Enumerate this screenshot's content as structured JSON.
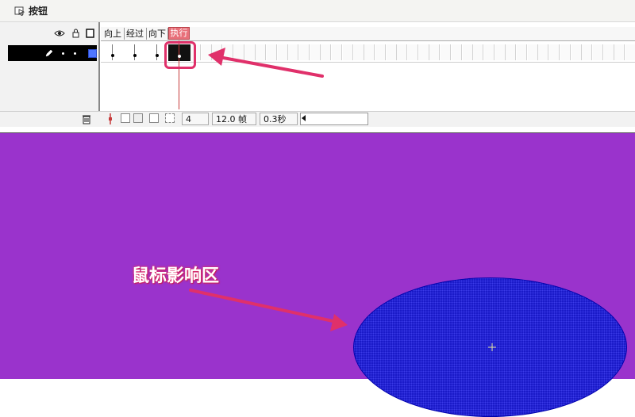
{
  "scene": {
    "label": "按钮",
    "icon": "button-symbol-icon"
  },
  "timeline": {
    "layer_header_icons": [
      "eye-icon",
      "lock-icon",
      "outline-icon"
    ],
    "layer": {
      "icons": [
        "pencil-icon"
      ],
      "color": "#4f76ff"
    },
    "frame_labels": [
      "向上",
      "经过",
      "向下",
      "执行"
    ],
    "current_frame_label": "执行"
  },
  "status_bar": {
    "current_frame": "4",
    "frame_rate": "12.0 帧",
    "elapsed_time": "0.3秒",
    "icons": [
      "trash-icon",
      "center-frame-icon",
      "onion-skin-icon",
      "onion-skin-outline-icon",
      "edit-multiple-frames-icon",
      "modify-onion-markers-icon"
    ]
  },
  "stage": {
    "background": "#9a33cc",
    "shape_fill": "#1a1ac8",
    "annotation": "鼠标影响区"
  },
  "colors": {
    "highlight": "#e0306a"
  }
}
